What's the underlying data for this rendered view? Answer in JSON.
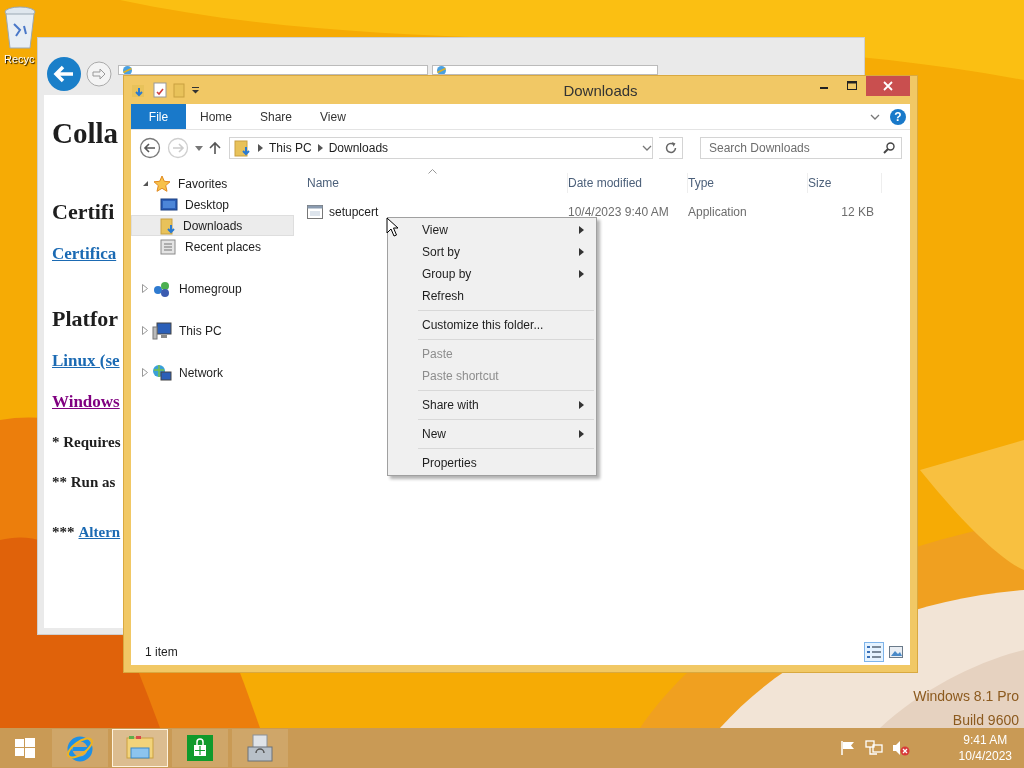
{
  "desktop": {
    "icons": [
      {
        "kind": "recycle",
        "label": "Recyc"
      }
    ],
    "os_edition": "Windows 8.1 Pro",
    "os_build": "Build 9600"
  },
  "browser": {
    "content": [
      {
        "kind": "h1",
        "text": "Colla"
      },
      {
        "kind": "h2",
        "text": "Certifi"
      },
      {
        "kind": "link",
        "text": "Certifica",
        "visited": false
      },
      {
        "kind": "h2",
        "text": "Platfor"
      },
      {
        "kind": "link",
        "text": "Linux (se",
        "visited": false
      },
      {
        "kind": "link",
        "text": "Windows",
        "visited": true
      },
      {
        "kind": "note",
        "text": "* Requires"
      },
      {
        "kind": "note",
        "text": "** Run as"
      },
      {
        "kind": "note_link",
        "prefix": "***",
        "text": "Altern"
      }
    ]
  },
  "explorer": {
    "title": "Downloads",
    "ribbon_tabs": [
      {
        "label": "File",
        "kind": "menu",
        "selected": false
      },
      {
        "label": "Home",
        "kind": "tab",
        "selected": false
      },
      {
        "label": "Share",
        "kind": "tab",
        "selected": false
      },
      {
        "label": "View",
        "kind": "tab",
        "selected": false
      }
    ],
    "help_button": "?",
    "breadcrumb": [
      "This PC",
      "Downloads"
    ],
    "search": {
      "placeholder": "Search Downloads"
    },
    "nav": [
      {
        "label": "Favorites",
        "kind": "favorites",
        "expanded": true,
        "selected": false,
        "children": [
          {
            "label": "Desktop",
            "kind": "desktop",
            "selected": false
          },
          {
            "label": "Downloads",
            "kind": "downloads",
            "selected": true
          },
          {
            "label": "Recent places",
            "kind": "recent",
            "selected": false
          }
        ]
      },
      {
        "label": "Homegroup",
        "kind": "homegroup",
        "expanded": false,
        "selected": false
      },
      {
        "label": "This PC",
        "kind": "pc",
        "expanded": false,
        "selected": false
      },
      {
        "label": "Network",
        "kind": "network",
        "expanded": false,
        "selected": false
      }
    ],
    "columns": [
      {
        "label": "Name",
        "sorted": true
      },
      {
        "label": "Date modified",
        "sorted": false
      },
      {
        "label": "Type",
        "sorted": false
      },
      {
        "label": "Size",
        "sorted": false
      }
    ],
    "files": [
      {
        "name": "setupcert",
        "date_modified": "10/4/2023 9:40 AM",
        "type": "Application",
        "size": "12 KB",
        "selected": false
      }
    ],
    "status": "1 item",
    "views": [
      {
        "kind": "details",
        "selected": true
      },
      {
        "kind": "large_icons",
        "selected": false
      }
    ]
  },
  "context_menu": [
    [
      {
        "label": "View",
        "submenu": true,
        "disabled": false
      },
      {
        "label": "Sort by",
        "submenu": true,
        "disabled": false
      },
      {
        "label": "Group by",
        "submenu": true,
        "disabled": false
      },
      {
        "label": "Refresh",
        "submenu": false,
        "disabled": false
      }
    ],
    [
      {
        "label": "Customize this folder...",
        "submenu": false,
        "disabled": false
      }
    ],
    [
      {
        "label": "Paste",
        "submenu": false,
        "disabled": true
      },
      {
        "label": "Paste shortcut",
        "submenu": false,
        "disabled": true
      }
    ],
    [
      {
        "label": "Share with",
        "submenu": true,
        "disabled": false
      }
    ],
    [
      {
        "label": "New",
        "submenu": true,
        "disabled": false
      }
    ],
    [
      {
        "label": "Properties",
        "submenu": false,
        "disabled": false
      }
    ]
  ],
  "taskbar": {
    "apps": [
      {
        "kind": "ie",
        "selected": false
      },
      {
        "kind": "explorer",
        "selected": true
      },
      {
        "kind": "store",
        "selected": false
      },
      {
        "kind": "installer",
        "selected": false
      }
    ],
    "clock": {
      "time": "9:41 AM",
      "date": "10/4/2023"
    }
  }
}
